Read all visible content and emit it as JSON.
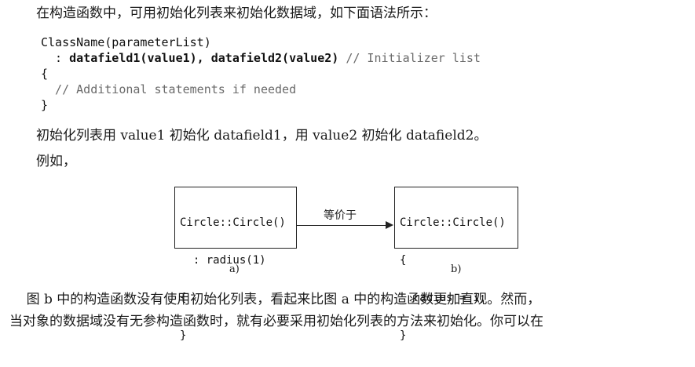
{
  "intro": "在构造函数中，可用初始化列表来初始化数据域，如下面语法所示：",
  "syntax": {
    "line1": "ClassName(parameterList)",
    "line2_prefix": "  : ",
    "line2_bold": "datafield1(value1), datafield2(value2)",
    "line2_comment": " // Initializer list",
    "line3": "{",
    "line4_comment": "  // Additional statements if needed",
    "line5": "}"
  },
  "explain": "初始化列表用 value1 初始化 datafield1，用 value2 初始化 datafield2。",
  "example": "例如，",
  "figure": {
    "box_a": {
      "l1": "Circle::Circle()",
      "l2": "  : radius(1)",
      "l3": "{",
      "l4": "}"
    },
    "box_b": {
      "l1": "Circle::Circle()",
      "l2": "{",
      "l3": "  radius = 1;",
      "l4": "}"
    },
    "arrow_label": "等价于",
    "caption_a": "a)",
    "caption_b": "b)"
  },
  "para1": "    图 b 中的构造函数没有使用初始化列表，看起来比图 a 中的构造函数更加直观。然而，",
  "para2": "当对象的数据域没有无参构造函数时，就有必要采用初始化列表的方法来初始化。你可以在"
}
